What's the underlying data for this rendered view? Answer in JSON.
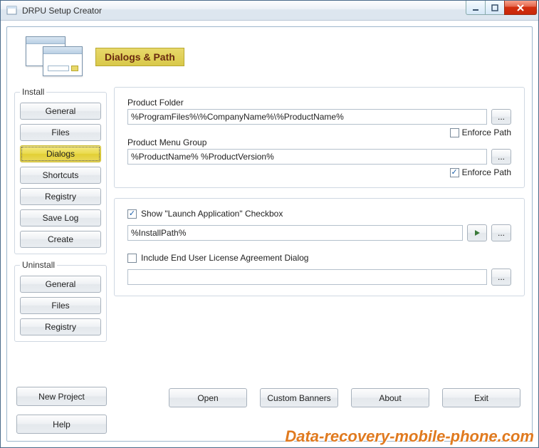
{
  "window": {
    "title": "DRPU Setup Creator"
  },
  "header": {
    "badge": "Dialogs & Path"
  },
  "sidebar": {
    "install": {
      "legend": "Install",
      "items": [
        {
          "label": "General"
        },
        {
          "label": "Files"
        },
        {
          "label": "Dialogs"
        },
        {
          "label": "Shortcuts"
        },
        {
          "label": "Registry"
        },
        {
          "label": "Save Log"
        },
        {
          "label": "Create"
        }
      ]
    },
    "uninstall": {
      "legend": "Uninstall",
      "items": [
        {
          "label": "General"
        },
        {
          "label": "Files"
        },
        {
          "label": "Registry"
        }
      ]
    }
  },
  "form": {
    "productFolder": {
      "label": "Product Folder",
      "value": "%ProgramFiles%\\%CompanyName%\\%ProductName%",
      "enforceLabel": "Enforce Path",
      "enforceChecked": false
    },
    "productMenuGroup": {
      "label": "Product Menu Group",
      "value": "%ProductName% %ProductVersion%",
      "enforceLabel": "Enforce Path",
      "enforceChecked": true
    },
    "launch": {
      "checkboxLabel": "Show \"Launch Application\" Checkbox",
      "checked": true,
      "value": "%InstallPath%"
    },
    "eula": {
      "checkboxLabel": "Include End User License Agreement Dialog",
      "checked": false,
      "value": ""
    }
  },
  "footer": {
    "left": {
      "newProject": "New Project",
      "help": "Help"
    },
    "right": {
      "open": "Open",
      "customBanners": "Custom Banners",
      "about": "About",
      "exit": "Exit"
    }
  },
  "watermark": "Data-recovery-mobile-phone.com"
}
